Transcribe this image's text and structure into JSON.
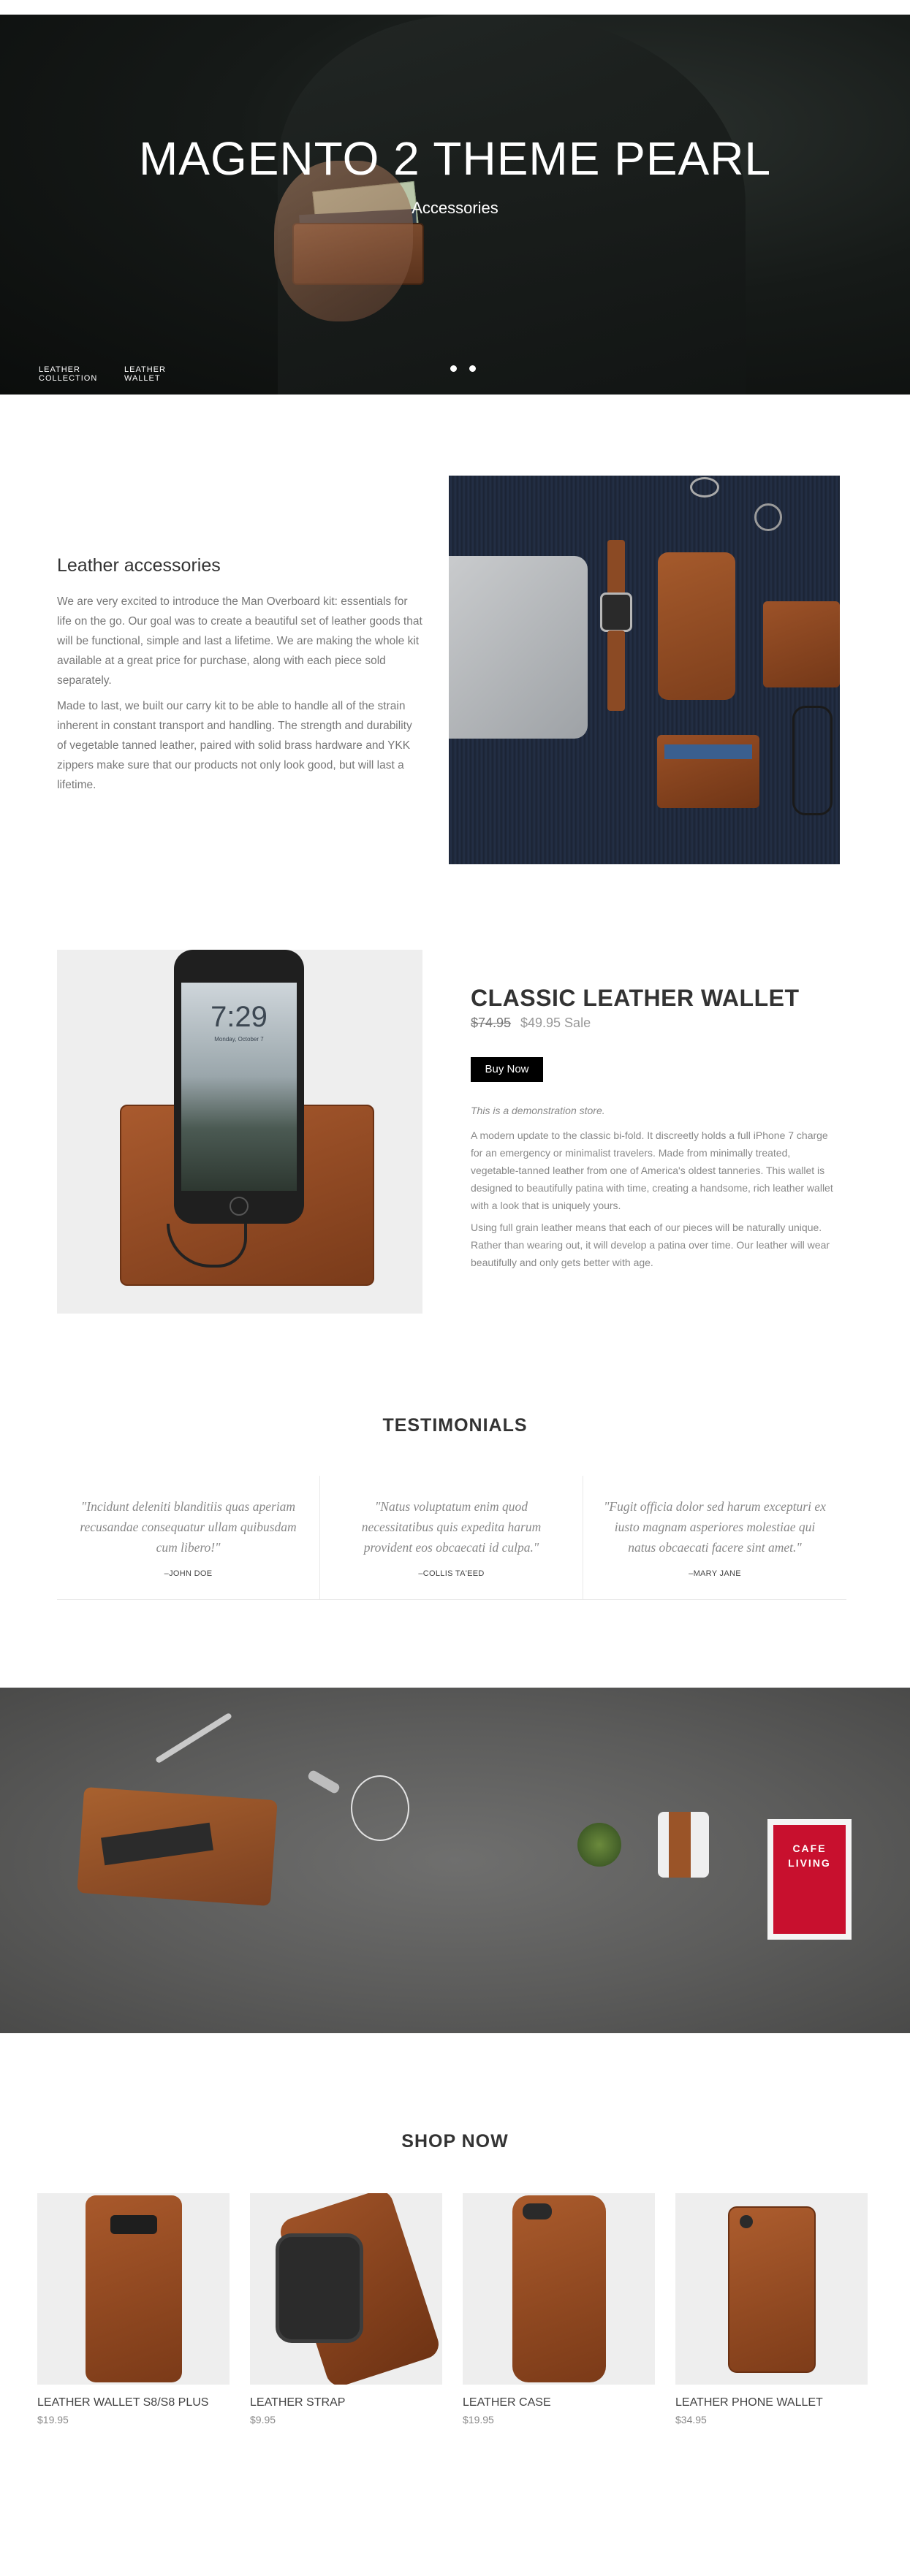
{
  "hero": {
    "title": "MAGENTO 2 THEME PEARL",
    "subtitle": "Accessories",
    "links": [
      {
        "line1": "LEATHER",
        "line2": "COLLECTION"
      },
      {
        "line1": "LEATHER",
        "line2": "WALLET"
      }
    ],
    "slides": 2
  },
  "about": {
    "heading": "Leather accessories",
    "paragraph1": "We are very excited to introduce the Man Overboard kit: essentials for life on the go. Our goal was to create a beautiful set of leather goods that will be functional, simple and last a lifetime. We are making the whole kit available at a great price for purchase, along with each piece sold separately.",
    "paragraph2": "Made to last, we built our carry kit to be able to handle all of the strain inherent in constant transport and handling. The strength and durability of vegetable tanned leather, paired with solid brass hardware and YKK zippers make sure that our products not only look good, but will last a lifetime."
  },
  "product": {
    "title": "CLASSIC LEATHER WALLET",
    "old_price": "$74.95",
    "sale_price": "$49.95 Sale",
    "buy_label": "Buy Now",
    "demo_note": "This is a demonstration store.",
    "paragraph1": "A modern update to the classic bi-fold. It discreetly holds a full iPhone 7 charge for an emergency or minimalist travelers. Made from minimally treated, vegetable-tanned leather from one of America's oldest tanneries. This wallet is designed to beautifully patina with time, creating a handsome, rich leather wallet with a look that is uniquely yours.",
    "paragraph2": "Using full grain leather means that each of our pieces will be naturally unique. Rather than wearing out, it will develop a patina over time. Our leather will wear beautifully and only gets better with age.",
    "phone_time": "7:29",
    "phone_date": "Monday, October 7"
  },
  "testimonials": {
    "title": "TESTIMONIALS",
    "items": [
      {
        "quote": "\"Incidunt deleniti blanditiis quas aperiam recusandae consequatur ullam quibusdam cum libero!\"",
        "author": "–JOHN DOE"
      },
      {
        "quote": "\"Natus voluptatum enim quod necessitatibus quis expedita harum provident eos obcaecati id culpa.\"",
        "author": "–COLLIS TA'EED"
      },
      {
        "quote": "\"Fugit officia dolor sed harum excepturi ex iusto magnam asperiores molestiae qui natus obcaecati facere sint amet.\"",
        "author": "–MARY JANE"
      }
    ]
  },
  "banner": {
    "book_line1": "CAFE",
    "book_line2": "LIVING"
  },
  "shop": {
    "title": "SHOP NOW",
    "products": [
      {
        "name": "LEATHER WALLET S8/S8 PLUS",
        "price": "$19.95"
      },
      {
        "name": "LEATHER STRAP",
        "price": "$9.95"
      },
      {
        "name": "LEATHER CASE",
        "price": "$19.95"
      },
      {
        "name": "LEATHER PHONE WALLET",
        "price": "$34.95"
      }
    ]
  },
  "colors": {
    "leather": "#8b4a24",
    "button": "#000000",
    "hero_bg": "#111514"
  }
}
